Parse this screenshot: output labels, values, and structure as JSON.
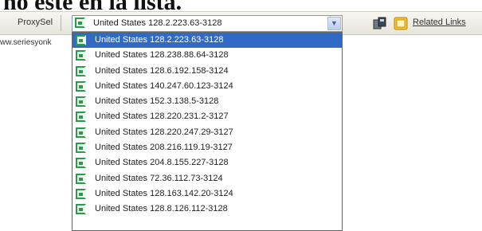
{
  "caption": "no este en la lista.",
  "toolbar": {
    "label": "ProxySel",
    "combo_value": "United States 128.2.223.63-3128",
    "related_links": "Related Links"
  },
  "address_bar": {
    "text": "ww.seriesyonk"
  },
  "dropdown": {
    "items": [
      "United States 128.2.223.63-3128",
      "United States 128.238.88.64-3128",
      "United States 128.6.192.158-3124",
      "United States 140.247.60.123-3124",
      "United States 152.3.138.5-3128",
      "United States 128.220.231.2-3127",
      "United States 128.220.247.29-3127",
      "United States 208.216.119.19-3127",
      "United States 204.8.155.227-3128",
      "United States 72.36.112.73-3124",
      "United States 128.163.142.20-3124",
      "United States 128.8.126.112-3128"
    ],
    "selected_index": 0
  },
  "colors": {
    "selection": "#316ac5",
    "icon_green": "#2a9b4a"
  }
}
